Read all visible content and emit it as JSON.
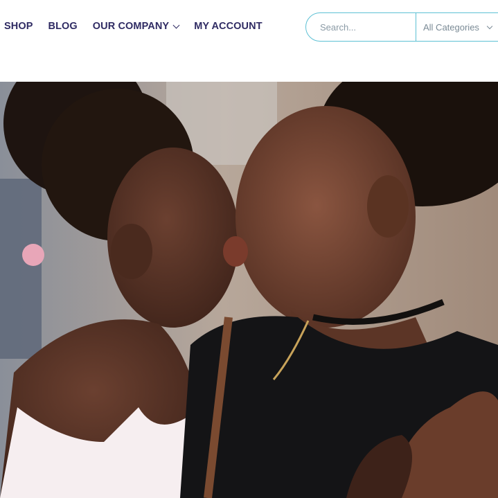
{
  "nav": {
    "items": [
      {
        "label": "SHOP"
      },
      {
        "label": "BLOG"
      },
      {
        "label": "OUR COMPANY",
        "has_dropdown": true
      },
      {
        "label": "MY ACCOUNT"
      }
    ]
  },
  "search": {
    "placeholder": "Search...",
    "category_selected": "All Categories"
  },
  "hero": {
    "image_description_icon": "hero-photo"
  },
  "colors": {
    "nav_text": "#2f2b63",
    "search_border": "#5cc0d4"
  }
}
